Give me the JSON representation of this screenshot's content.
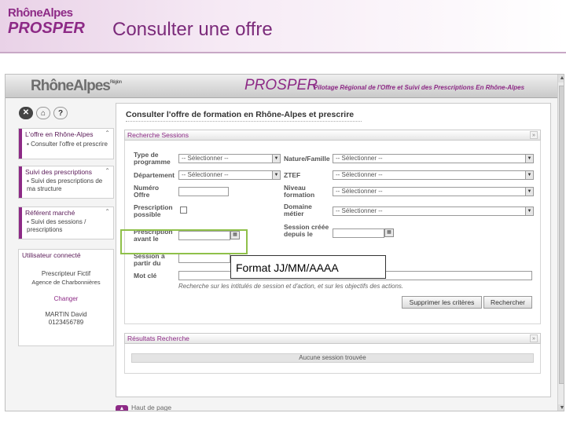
{
  "slide": {
    "logo_top": "RhôneAlpes",
    "logo_bottom": "PROSPER",
    "title": "Consulter une offre"
  },
  "banner": {
    "logo": "RhôneAlpes",
    "logo_sup": "Région",
    "prosper": "PROSPER",
    "tagline": "Pilotage Régional de l'Offre et Suivi des Prescriptions En Rhône-Alpes"
  },
  "sidebar": {
    "icons": [
      {
        "glyph": "✕",
        "name": "close"
      },
      {
        "glyph": "⌂",
        "name": "home"
      },
      {
        "glyph": "?",
        "name": "help"
      }
    ],
    "boxes": [
      {
        "title": "L'offre en Rhône-Alpes",
        "items": [
          "Consulter l'offre et prescrire"
        ]
      },
      {
        "title": "Suivi des prescriptions",
        "items": [
          "Suivi des prescriptions de ma structure"
        ]
      },
      {
        "title": "Référent marché",
        "items": [
          "Suivi des sessions / prescriptions"
        ]
      }
    ],
    "user": {
      "title": "Utilisateur connecté",
      "role": "Prescripteur Fictif",
      "agency": "Agence de Charbonnières",
      "change": "Changer",
      "name": "MARTIN David",
      "phone": "0123456789"
    }
  },
  "main": {
    "title": "Consulter l'offre de formation en Rhône-Alpes et prescrire",
    "search_panel": "Recherche Sessions",
    "fields": {
      "type_programme": {
        "label": "Type de programme",
        "value": "-- Sélectionner --"
      },
      "departement": {
        "label": "Département",
        "value": "-- Sélectionner --"
      },
      "numero_offre": {
        "label": "Numéro Offre"
      },
      "prescription_possible": {
        "label": "Prescription possible"
      },
      "prescription_avant": {
        "label": "Prescription avant le"
      },
      "session_a_partir": {
        "label": "Session à partir du"
      },
      "mot_cle": {
        "label": "Mot clé"
      },
      "nature_famille": {
        "label": "Nature/Famille",
        "value": "-- Sélectionner --"
      },
      "ztef": {
        "label": "ZTEF",
        "value": "-- Sélectionner --"
      },
      "niveau_formation": {
        "label": "Niveau formation",
        "value": "-- Sélectionner --"
      },
      "domaine_metier": {
        "label": "Domaine métier",
        "value": "-- Sélectionner --"
      },
      "session_creee": {
        "label": "Session créée depuis le"
      }
    },
    "hint": "Recherche sur les intitulés de session et d'action, et sur les objectifs des actions.",
    "btn_clear": "Supprimer les critères",
    "btn_search": "Rechercher",
    "results_panel": "Résultats Recherche",
    "no_result": "Aucune session trouvée",
    "top_page": "Haut de page",
    "tooltip": "Format JJ/MM/AAAA"
  }
}
